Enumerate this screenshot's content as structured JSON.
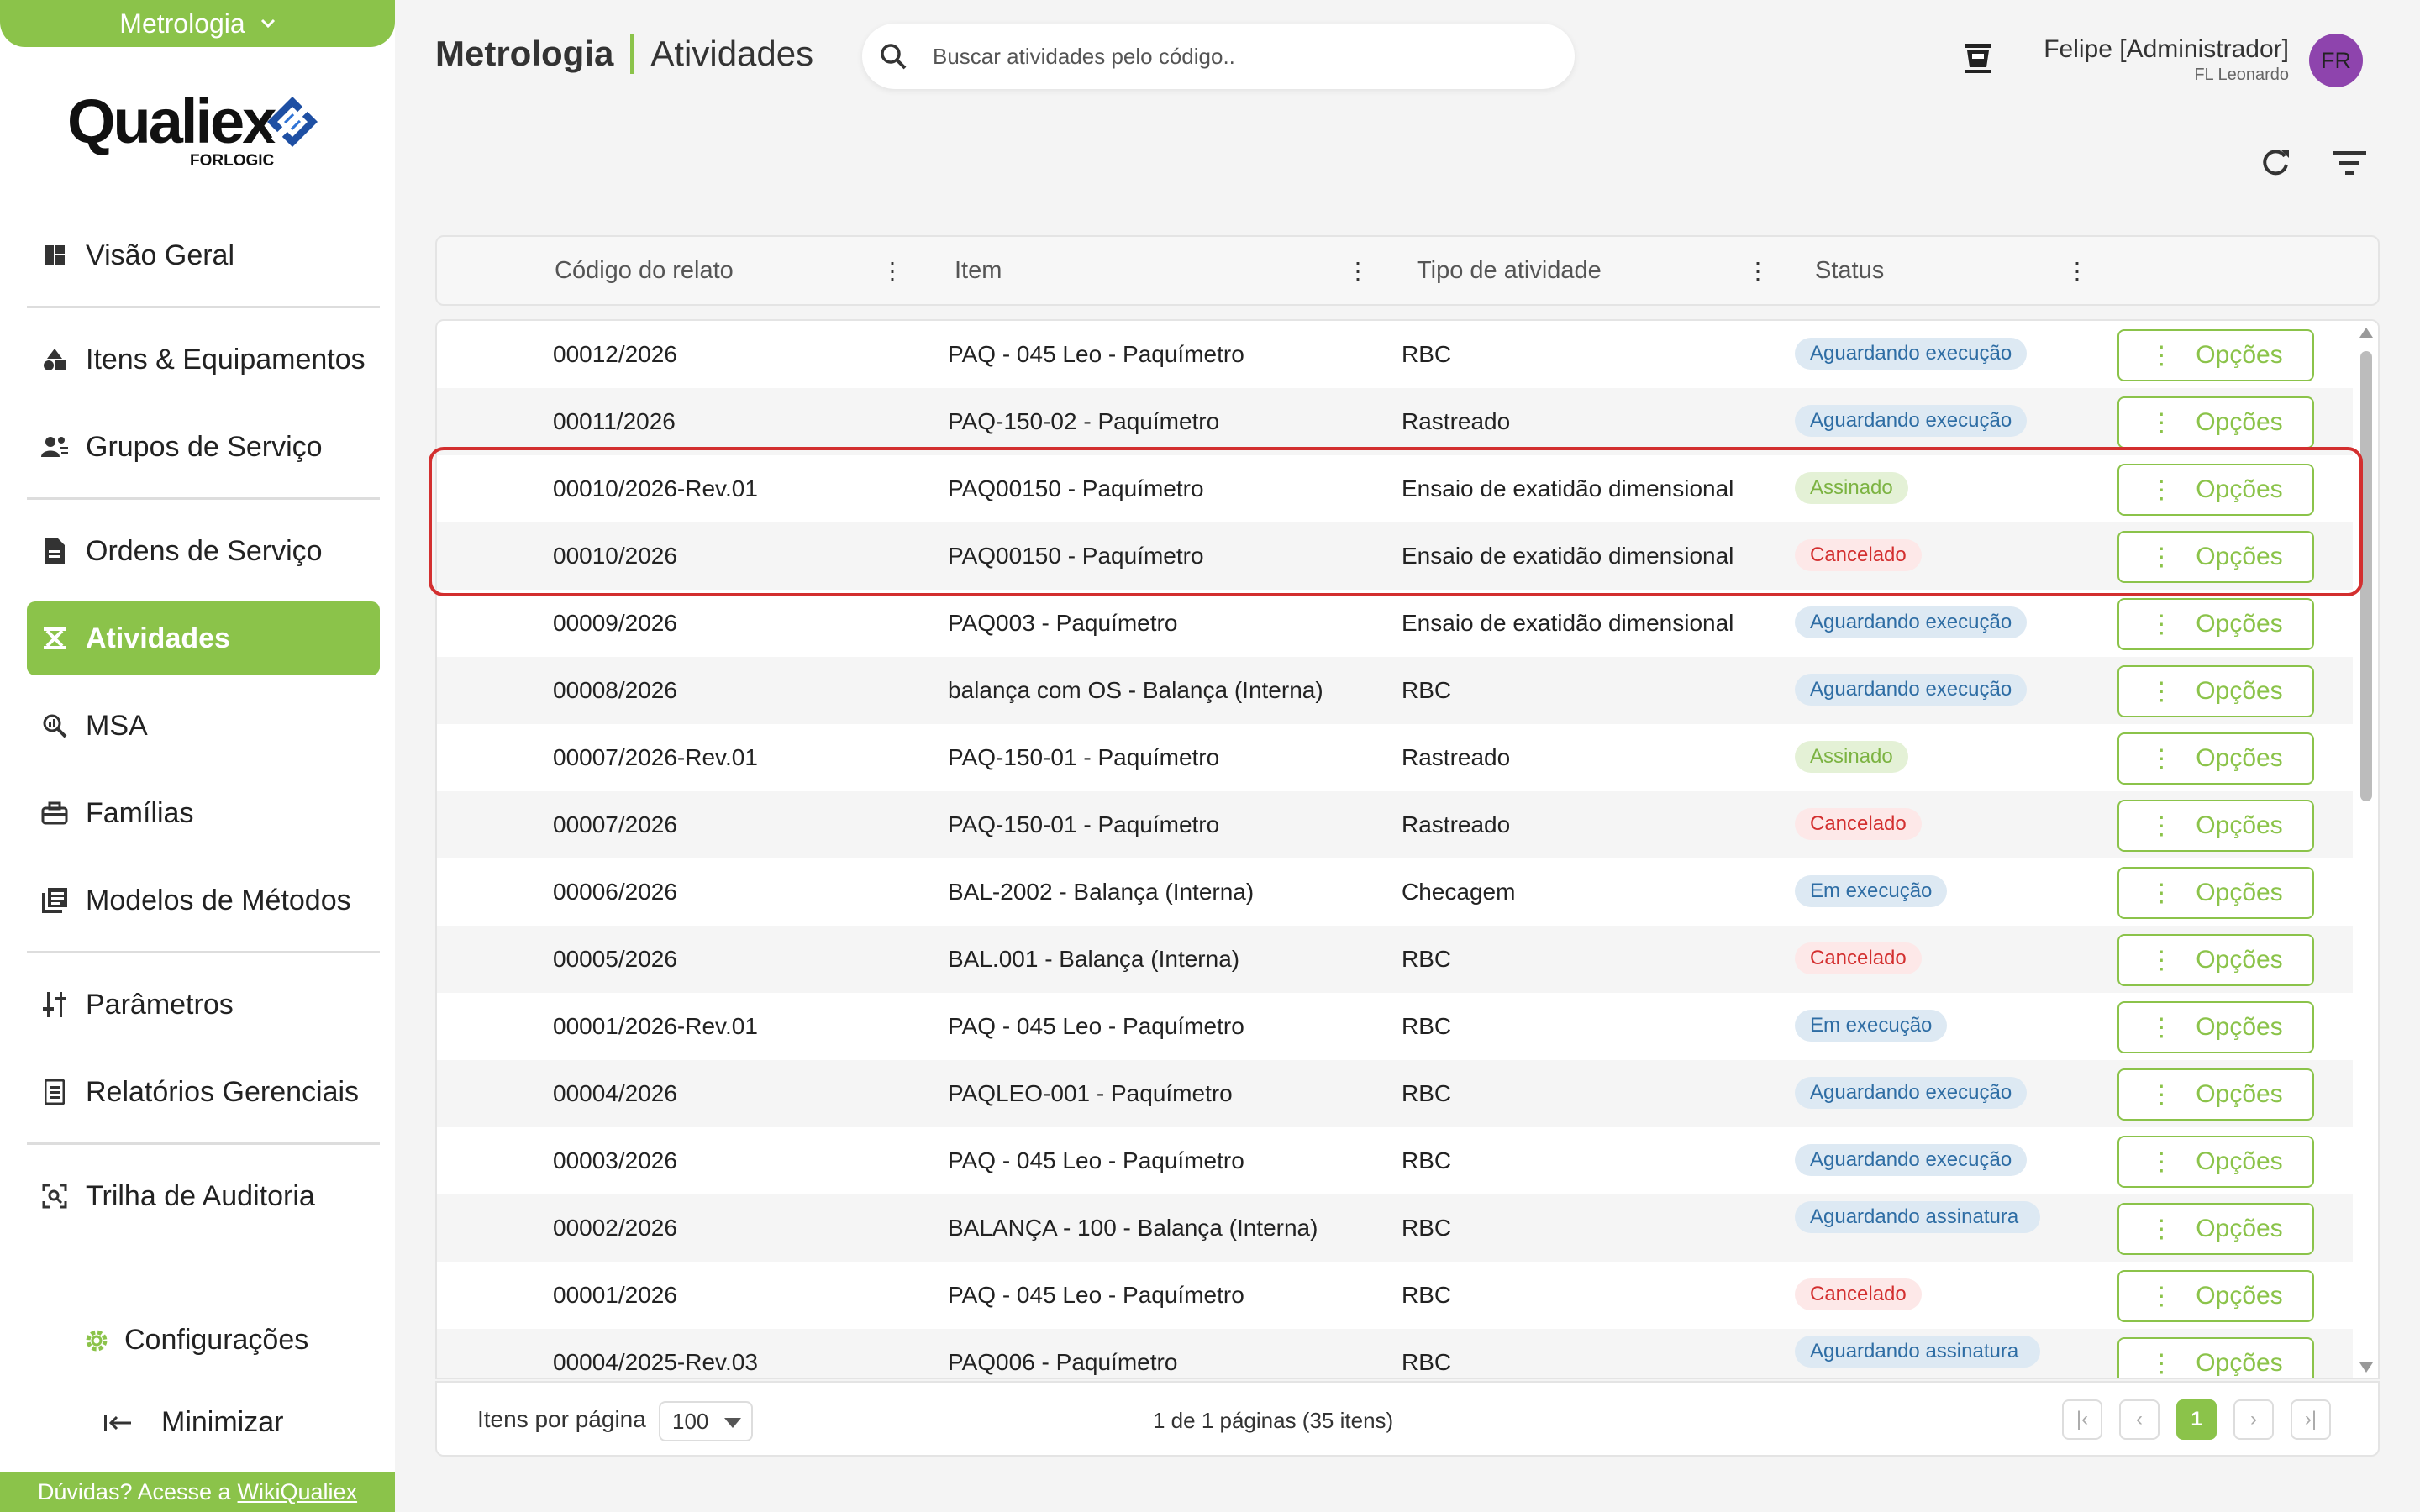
{
  "module": {
    "label": "Metrologia"
  },
  "brand": {
    "name": "Qualiex",
    "sub": "FORLOGIC"
  },
  "nav": {
    "items": [
      {
        "label": "Visão Geral",
        "icon": "dashboard-icon"
      },
      {
        "label": "Itens & Equipamentos",
        "icon": "shapes-icon"
      },
      {
        "label": "Grupos de Serviço",
        "icon": "users-group-icon"
      },
      {
        "label": "Ordens de Serviço",
        "icon": "document-icon"
      },
      {
        "label": "Atividades",
        "icon": "activity-icon"
      },
      {
        "label": "MSA",
        "icon": "search-analysis-icon"
      },
      {
        "label": "Famílias",
        "icon": "toolbox-icon"
      },
      {
        "label": "Modelos de Métodos",
        "icon": "library-icon"
      },
      {
        "label": "Parâmetros",
        "icon": "sliders-icon"
      },
      {
        "label": "Relatórios Gerenciais",
        "icon": "report-icon"
      },
      {
        "label": "Trilha de Auditoria",
        "icon": "audit-icon"
      }
    ],
    "config": "Configurações",
    "minimize": "Minimizar"
  },
  "help": {
    "text": "Dúvidas? Acesse a",
    "link": "WikiQualiex"
  },
  "header": {
    "module": "Metrologia",
    "page": "Atividades",
    "search_placeholder": "Buscar atividades pelo código.."
  },
  "user": {
    "name": "Felipe [Administrador]",
    "org": "FL Leonardo",
    "initials": "FR"
  },
  "table": {
    "columns": [
      "Código do relato",
      "Item",
      "Tipo de atividade",
      "Status"
    ],
    "options_label": "Opções",
    "rows": [
      {
        "code": "00012/2026",
        "item": "PAQ - 045 Leo - Paquímetro",
        "type": "RBC",
        "status": "Aguardando execução",
        "tone": "blue"
      },
      {
        "code": "00011/2026",
        "item": "PAQ-150-02 - Paquímetro",
        "type": "Rastreado",
        "status": "Aguardando execução",
        "tone": "blue"
      },
      {
        "code": "00010/2026-Rev.01",
        "item": "PAQ00150 - Paquímetro",
        "type": "Ensaio de exatidão dimensional",
        "status": "Assinado",
        "tone": "green"
      },
      {
        "code": "00010/2026",
        "item": "PAQ00150 - Paquímetro",
        "type": "Ensaio de exatidão dimensional",
        "status": "Cancelado",
        "tone": "red"
      },
      {
        "code": "00009/2026",
        "item": "PAQ003 - Paquímetro",
        "type": "Ensaio de exatidão dimensional",
        "status": "Aguardando execução",
        "tone": "blue"
      },
      {
        "code": "00008/2026",
        "item": "balança com OS - Balança (Interna)",
        "type": "RBC",
        "status": "Aguardando execução",
        "tone": "blue"
      },
      {
        "code": "00007/2026-Rev.01",
        "item": "PAQ-150-01 - Paquímetro",
        "type": "Rastreado",
        "status": "Assinado",
        "tone": "green"
      },
      {
        "code": "00007/2026",
        "item": "PAQ-150-01 - Paquímetro",
        "type": "Rastreado",
        "status": "Cancelado",
        "tone": "red"
      },
      {
        "code": "00006/2026",
        "item": "BAL-2002 - Balança (Interna)",
        "type": "Checagem",
        "status": "Em execução",
        "tone": "blue"
      },
      {
        "code": "00005/2026",
        "item": "BAL.001 - Balança (Interna)",
        "type": "RBC",
        "status": "Cancelado",
        "tone": "red"
      },
      {
        "code": "00001/2026-Rev.01",
        "item": "PAQ - 045 Leo - Paquímetro",
        "type": "RBC",
        "status": "Em execução",
        "tone": "blue"
      },
      {
        "code": "00004/2026",
        "item": "PAQLEO-001 - Paquímetro",
        "type": "RBC",
        "status": "Aguardando execução",
        "tone": "blue"
      },
      {
        "code": "00003/2026",
        "item": "PAQ - 045 Leo - Paquímetro",
        "type": "RBC",
        "status": "Aguardando execução",
        "tone": "blue"
      },
      {
        "code": "00002/2026",
        "item": "BALANÇA - 100 - Balança (Interna)",
        "type": "RBC",
        "status": "Aguardando assinatura",
        "tone": "blue"
      },
      {
        "code": "00001/2026",
        "item": "PAQ - 045 Leo - Paquímetro",
        "type": "RBC",
        "status": "Cancelado",
        "tone": "red"
      },
      {
        "code": "00004/2025-Rev.03",
        "item": "PAQ006 - Paquímetro",
        "type": "RBC",
        "status": "Aguardando assinatura",
        "tone": "blue"
      }
    ]
  },
  "footer": {
    "per_page_label": "Itens por página",
    "per_page_value": "100",
    "page_info": "1 de 1 páginas (35 itens)",
    "current_page": "1"
  }
}
